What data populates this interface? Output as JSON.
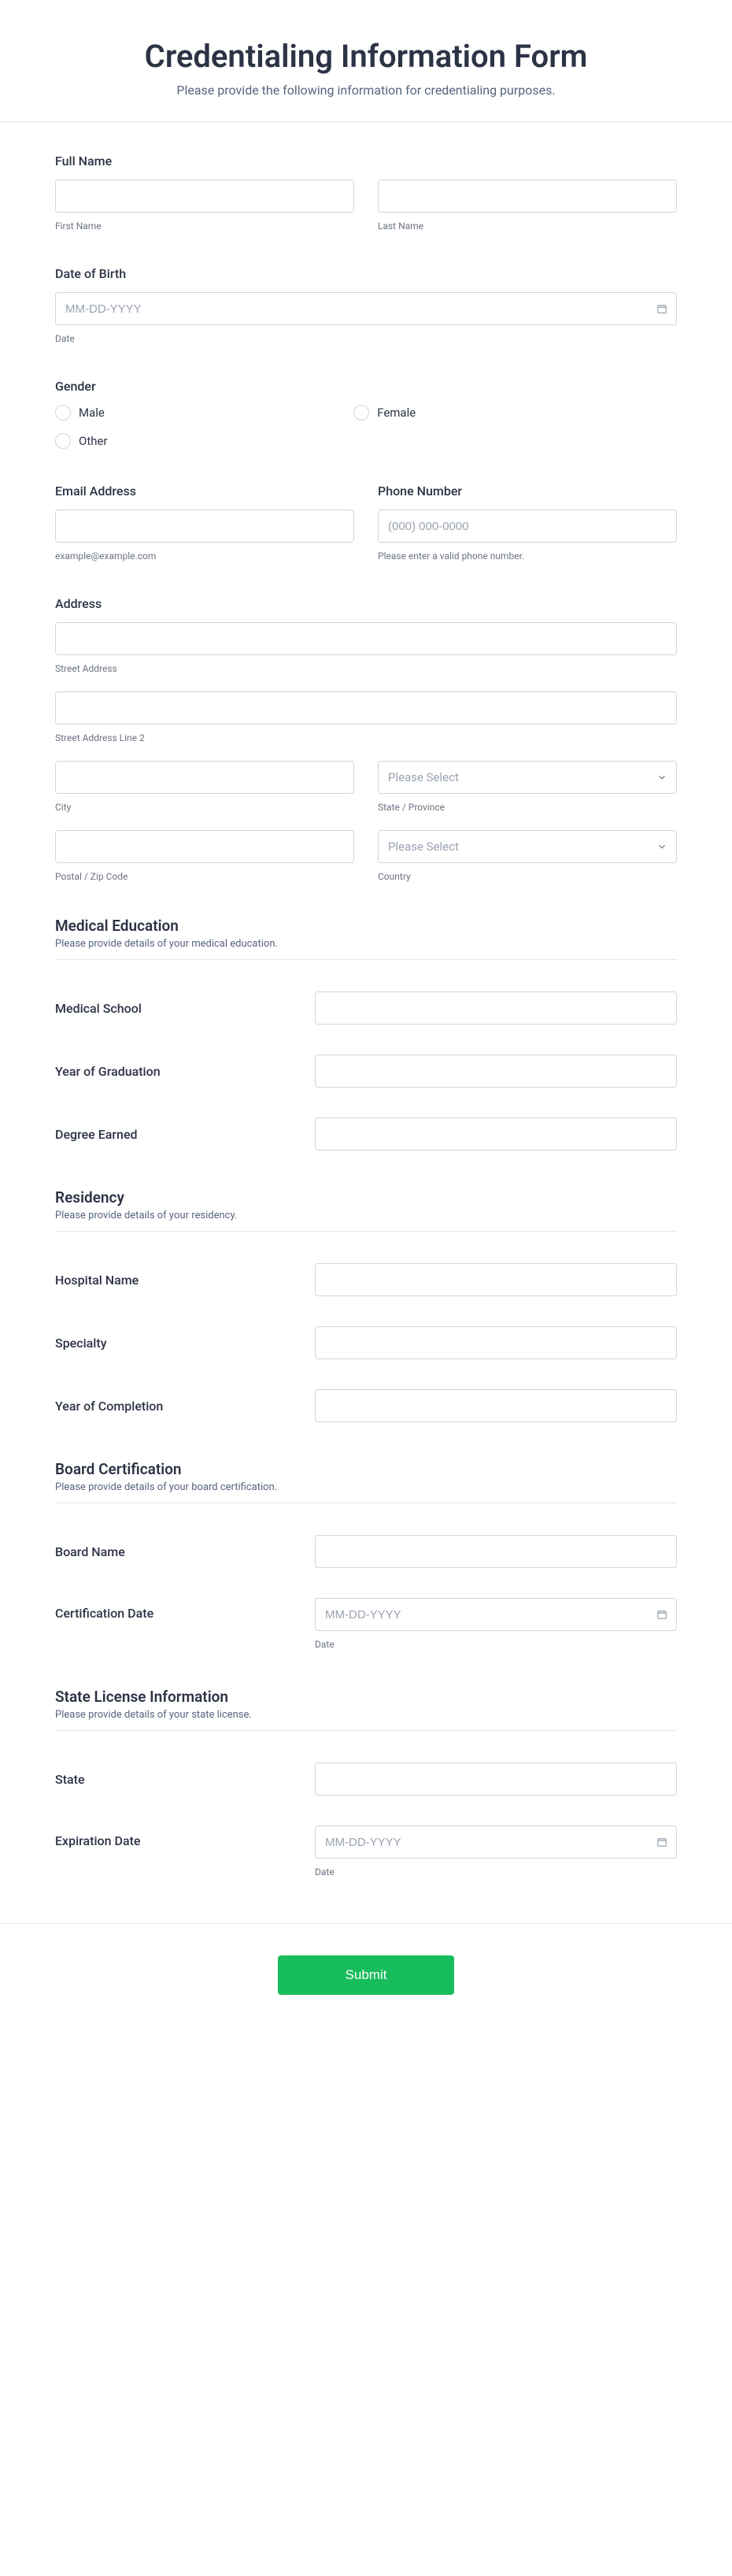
{
  "header": {
    "title": "Credentialing Information Form",
    "subtitle": "Please provide the following information for credentialing purposes."
  },
  "fullName": {
    "label": "Full Name",
    "firstSub": "First Name",
    "lastSub": "Last Name"
  },
  "dob": {
    "label": "Date of Birth",
    "placeholder": "MM-DD-YYYY",
    "sub": "Date"
  },
  "gender": {
    "label": "Gender",
    "options": [
      "Male",
      "Female",
      "Other"
    ]
  },
  "email": {
    "label": "Email Address",
    "sub": "example@example.com"
  },
  "phone": {
    "label": "Phone Number",
    "placeholder": "(000) 000-0000",
    "sub": "Please enter a valid phone number."
  },
  "address": {
    "label": "Address",
    "streetSub": "Street Address",
    "street2Sub": "Street Address Line 2",
    "citySub": "City",
    "statePlaceholder": "Please Select",
    "stateSub": "State / Province",
    "postalSub": "Postal / Zip Code",
    "countryPlaceholder": "Please Select",
    "countrySub": "Country"
  },
  "medEd": {
    "title": "Medical Education",
    "desc": "Please provide details of your medical education.",
    "school": "Medical School",
    "gradYear": "Year of Graduation",
    "degree": "Degree Earned"
  },
  "residency": {
    "title": "Residency",
    "desc": "Please provide details of your residency.",
    "hospital": "Hospital Name",
    "specialty": "Specialty",
    "completion": "Year of Completion"
  },
  "boardCert": {
    "title": "Board Certification",
    "desc": "Please provide details of your board certification.",
    "boardName": "Board Name",
    "certDate": "Certification Date",
    "datePlaceholder": "MM-DD-YYYY",
    "dateSub": "Date"
  },
  "stateLicense": {
    "title": "State License Information",
    "desc": "Please provide details of your state license.",
    "state": "State",
    "expDate": "Expiration Date",
    "datePlaceholder": "MM-DD-YYYY",
    "dateSub": "Date"
  },
  "submit": "Submit"
}
